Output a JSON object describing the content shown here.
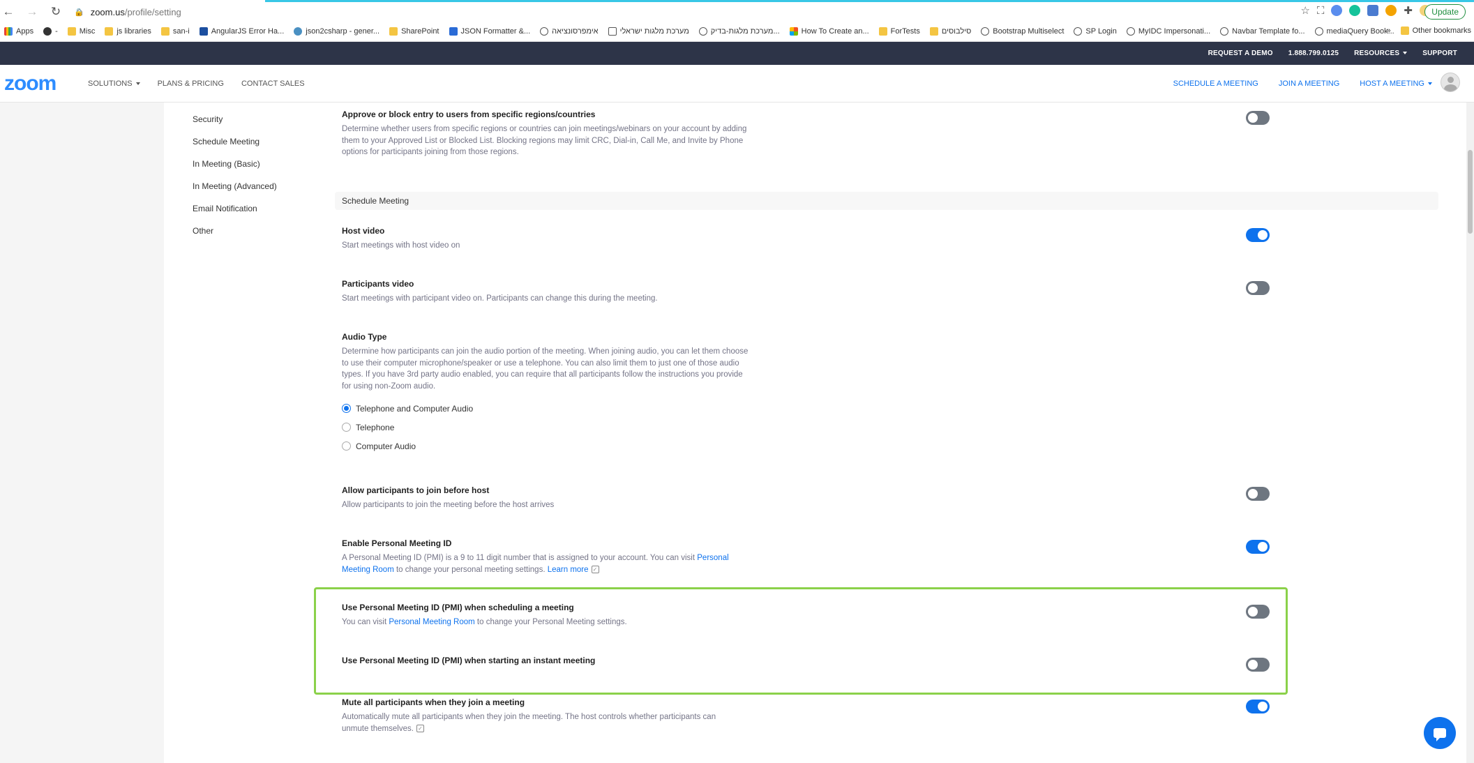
{
  "browser": {
    "url_host": "zoom.us",
    "url_path": "/profile/setting",
    "update_label": "Update",
    "bookmarks": [
      {
        "label": "Apps",
        "icon": "apps-grid-icon"
      },
      {
        "label": "-",
        "icon": "circle-a-icon"
      },
      {
        "label": "Misc",
        "icon": "folder-icon"
      },
      {
        "label": "js libraries",
        "icon": "folder-icon"
      },
      {
        "label": "san-i",
        "icon": "folder-icon"
      },
      {
        "label": "AngularJS Error Ha...",
        "icon": "jl-icon"
      },
      {
        "label": "json2csharp - gener...",
        "icon": "json2csharp-icon"
      },
      {
        "label": "SharePoint",
        "icon": "folder-icon"
      },
      {
        "label": "JSON Formatter &...",
        "icon": "checkbox-icon"
      },
      {
        "label": "אימפרסונציאה",
        "icon": "globe-icon"
      },
      {
        "label": "מערכת מלגות ישראלי",
        "icon": "doc-icon"
      },
      {
        "label": "מערכת מלגות-בדיק...",
        "icon": "globe-icon"
      },
      {
        "label": "How To Create an...",
        "icon": "microsoft-icon"
      },
      {
        "label": "ForTests",
        "icon": "folder-icon"
      },
      {
        "label": "סילבוסים",
        "icon": "folder-icon"
      },
      {
        "label": "Bootstrap Multiselect",
        "icon": "globe-icon"
      },
      {
        "label": "SP Login",
        "icon": "globe-icon"
      },
      {
        "label": "MyIDC Impersonati...",
        "icon": "globe-icon"
      },
      {
        "label": "Navbar Template fo...",
        "icon": "globe-icon"
      },
      {
        "label": "mediaQuery Book...",
        "icon": "globe-icon"
      }
    ],
    "other_bookmarks": "Other bookmarks",
    "more_chevron": "»"
  },
  "topbar": {
    "request_demo": "REQUEST A DEMO",
    "phone": "1.888.799.0125",
    "resources": "RESOURCES",
    "support": "SUPPORT"
  },
  "nav": {
    "logo": "zoom",
    "solutions": "SOLUTIONS",
    "plans": "PLANS & PRICING",
    "contact": "CONTACT SALES",
    "schedule": "SCHEDULE A MEETING",
    "join": "JOIN A MEETING",
    "host": "HOST A MEETING"
  },
  "sidemenu": [
    "Security",
    "Schedule Meeting",
    "In Meeting (Basic)",
    "In Meeting (Advanced)",
    "Email Notification",
    "Other"
  ],
  "settings": {
    "regions": {
      "title": "Approve or block entry to users from specific regions/countries",
      "desc": "Determine whether users from specific regions or countries can join meetings/webinars on your account by adding them to your Approved List or Blocked List. Blocking regions may limit CRC, Dial-in, Call Me, and Invite by Phone options for participants joining from those regions.",
      "on": false
    },
    "section_title": "Schedule Meeting",
    "host_video": {
      "title": "Host video",
      "desc": "Start meetings with host video on",
      "on": true
    },
    "participants_video": {
      "title": "Participants video",
      "desc": "Start meetings with participant video on. Participants can change this during the meeting.",
      "on": false
    },
    "audio_type": {
      "title": "Audio Type",
      "desc": "Determine how participants can join the audio portion of the meeting. When joining audio, you can let them choose to use their computer microphone/speaker or use a telephone. You can also limit them to just one of those audio types. If you have 3rd party audio enabled, you can require that all participants follow the instructions you provide for using non-Zoom audio.",
      "options": [
        "Telephone and Computer Audio",
        "Telephone",
        "Computer Audio"
      ],
      "selected": "Telephone and Computer Audio"
    },
    "join_before_host": {
      "title": "Allow participants to join before host",
      "desc": "Allow participants to join the meeting before the host arrives",
      "on": false
    },
    "pmi": {
      "title": "Enable Personal Meeting ID",
      "desc_pre": "A Personal Meeting ID (PMI) is a 9 to 11 digit number that is assigned to your account. You can visit ",
      "desc_link": "Personal Meeting Room",
      "desc_mid": " to change your personal meeting settings. ",
      "learn_more": "Learn more",
      "on": true
    },
    "pmi_schedule": {
      "title": "Use Personal Meeting ID (PMI) when scheduling a meeting",
      "desc_pre": "You can visit ",
      "desc_link": "Personal Meeting Room",
      "desc_post": " to change your Personal Meeting settings.",
      "on": false
    },
    "pmi_instant": {
      "title": "Use Personal Meeting ID (PMI) when starting an instant meeting",
      "on": false
    },
    "mute": {
      "title": "Mute all participants when they join a meeting",
      "desc": "Automatically mute all participants when they join the meeting. The host controls whether participants can unmute themselves.",
      "on": true
    }
  },
  "colors": {
    "accent": "#0e72ed",
    "highlight": "#8bd14a",
    "topbar": "#2d3448",
    "toggle_off": "#6e7680"
  }
}
